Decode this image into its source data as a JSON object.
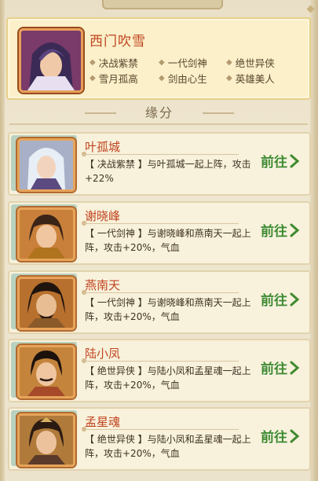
{
  "hero": {
    "name": "西门吹雪",
    "traits": [
      "决战紫禁",
      "一代剑神",
      "绝世异侠",
      "雪月孤高",
      "剑由心生",
      "英雄美人"
    ]
  },
  "section": {
    "title": "缘分"
  },
  "fates": [
    {
      "name": "叶孤城",
      "desc": "【 决战紫禁 】与叶孤城一起上阵，攻击+22%",
      "action": "前往"
    },
    {
      "name": "谢晓峰",
      "desc": "【 一代剑神 】与谢晓峰和燕南天一起上阵，攻击+20%，气血",
      "action": "前往"
    },
    {
      "name": "燕南天",
      "desc": "【 一代剑神 】与谢晓峰和燕南天一起上阵，攻击+20%，气血",
      "action": "前往"
    },
    {
      "name": "陆小凤",
      "desc": "【 绝世异侠 】与陆小凤和孟星魂一起上阵，攻击+20%，气血",
      "action": "前往"
    },
    {
      "name": "孟星魂",
      "desc": "【 绝世异侠 】与陆小凤和孟星魂一起上阵，攻击+20%，气血",
      "action": "前往"
    }
  ],
  "colors": {
    "name_red": "#c0441f",
    "go_green": "#3f8a2e",
    "panel": "#f8f1db"
  }
}
